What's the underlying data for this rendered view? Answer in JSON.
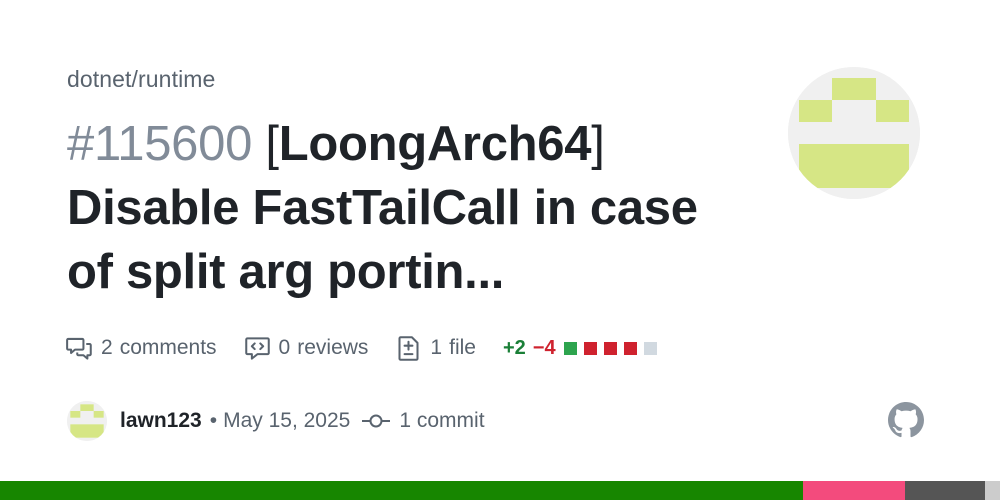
{
  "repo": "dotnet/runtime",
  "pr": {
    "number": "#115600",
    "bracket_open": "[",
    "tag": "LoongArch64",
    "bracket_close": "]",
    "title_rest": "Disable FastTailCall in case of split arg portin..."
  },
  "stats": {
    "comments_count": "2",
    "comments_label": "comments",
    "reviews_count": "0",
    "reviews_label": "reviews",
    "files_count": "1",
    "files_label": "file",
    "additions": "+2",
    "deletions": "−4",
    "diff_squares": [
      "#2da44e",
      "#cf222e",
      "#cf222e",
      "#cf222e",
      "#d1d9e0"
    ]
  },
  "meta": {
    "author": "lawn123",
    "separator": "•",
    "date": "May 15, 2025",
    "commits": "1 commit"
  },
  "colors": {
    "accent_avatar": "#d6e685",
    "lang_bar": [
      "#178600",
      "#178600",
      "#f34b7d",
      "#555555",
      "#ccc"
    ]
  },
  "icons": {
    "comments": "comment-discussion-icon",
    "reviews": "code-review-icon",
    "files": "file-diff-icon",
    "commit": "git-commit-icon",
    "brand": "github-mark-icon"
  }
}
